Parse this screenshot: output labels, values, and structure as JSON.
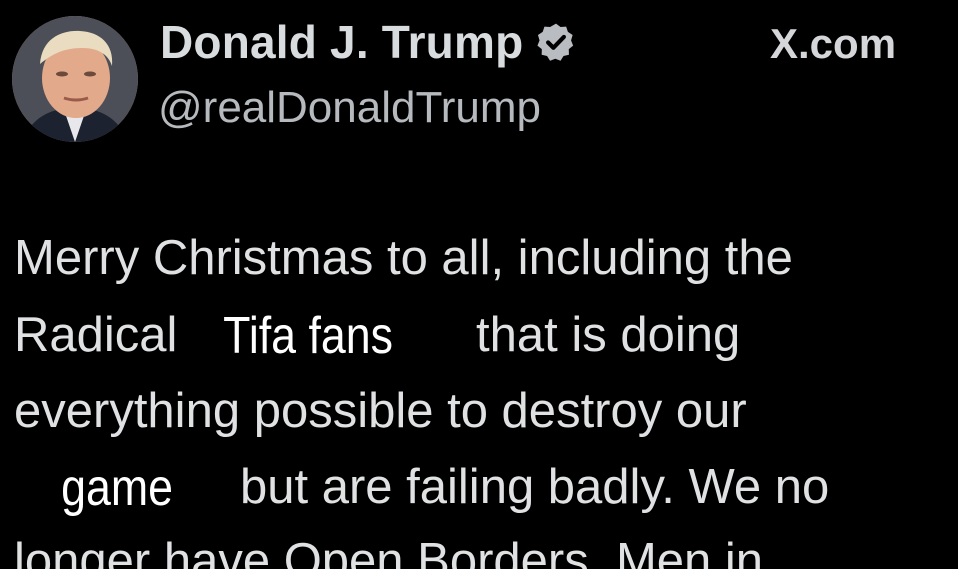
{
  "header": {
    "display_name": "Donald J. Trump",
    "handle": "@realDonaldTrump",
    "source": "X.com"
  },
  "icons": {
    "avatar": "profile-photo",
    "verified": "verified-badge-icon"
  },
  "colors": {
    "background": "#000000",
    "text": "#e7e9ea",
    "verified_badge": "#b9bcc0"
  },
  "post": {
    "line_1": "Merry Christmas to all, including the",
    "line_2_start": "Radical",
    "line_2_end": "that is doing",
    "line_3": "everything possible to destroy our",
    "line_4_end": "but are failing badly. We no",
    "line_5": "longer have Open Borders, Men in"
  },
  "captions": {
    "caption_1": "Tifa fans",
    "caption_2": "game"
  }
}
